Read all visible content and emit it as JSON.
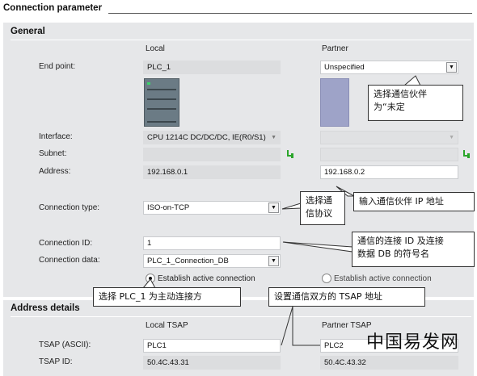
{
  "page_title": "Connection parameter",
  "general": {
    "heading": "General",
    "col_local": "Local",
    "col_partner": "Partner",
    "end_point": {
      "label": "End point:",
      "local": "PLC_1",
      "partner": "Unspecified"
    },
    "interface": {
      "label": "Interface:",
      "local": "CPU 1214C DC/DC/DC, IE(R0/S1)",
      "partner": ""
    },
    "subnet": {
      "label": "Subnet:",
      "local": "",
      "partner": ""
    },
    "address": {
      "label": "Address:",
      "local": "192.168.0.1",
      "partner": "192.168.0.2"
    },
    "connection_type": {
      "label": "Connection type:",
      "value": "ISO-on-TCP"
    },
    "connection_id": {
      "label": "Connection ID:",
      "value": "1"
    },
    "connection_data": {
      "label": "Connection data:",
      "value": "PLC_1_Connection_DB"
    },
    "establish_local": {
      "label": "Establish active connection",
      "selected": true
    },
    "establish_partner": {
      "label": "Establish active connection",
      "selected": false
    }
  },
  "address_details": {
    "heading": "Address details",
    "col_local": "Local TSAP",
    "col_partner": "Partner TSAP",
    "tsap_ascii": {
      "label": "TSAP (ASCII):",
      "local": "PLC1",
      "partner": "PLC2"
    },
    "tsap_id": {
      "label": "TSAP ID:",
      "local": "50.4C.43.31",
      "partner": "50.4C.43.32"
    }
  },
  "callouts": {
    "partner_unspecified": [
      "选择通信伙伴",
      "为“未定"
    ],
    "protocol": [
      "选择通",
      "信协议"
    ],
    "partner_ip": "输入通信伙伴 IP 地址",
    "conn_id_db": [
      "通信的连接 ID 及连接",
      "数据 DB 的符号名"
    ],
    "active_conn": "选择 PLC_1 为主动连接方",
    "tsap": "设置通信双方的 TSAP 地址"
  },
  "watermark": "中国易发网",
  "icons": {
    "dropdown": "chevron-down-icon",
    "network": "network-connect-icon"
  },
  "colors": {
    "panel_bg": "#e6e7e9",
    "partner_device": "#9ea3c8",
    "network_icon": "#2aa52a"
  }
}
